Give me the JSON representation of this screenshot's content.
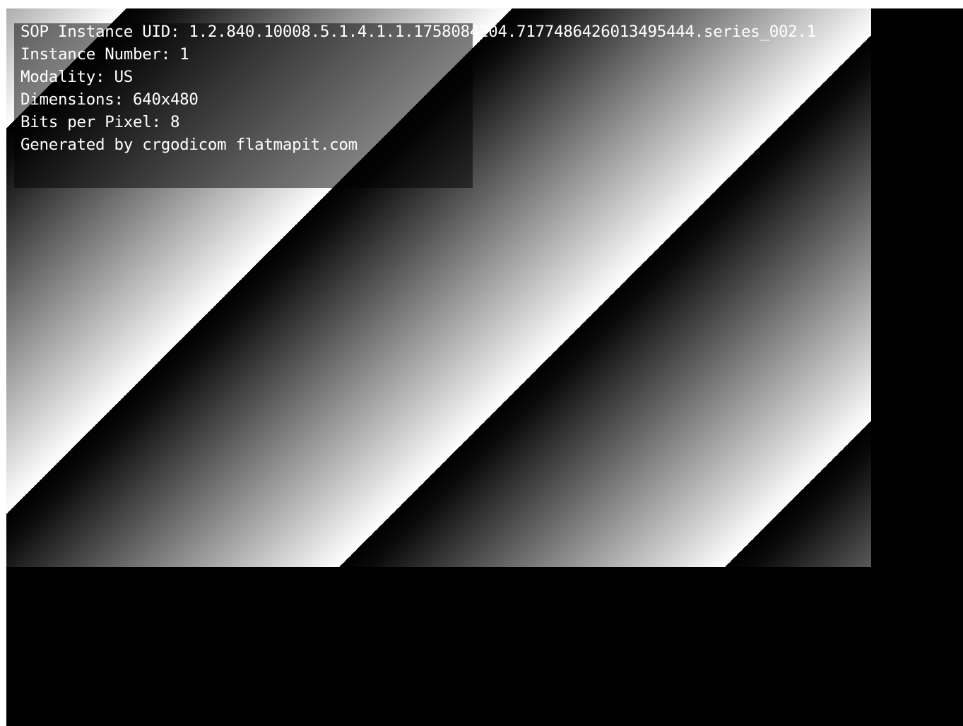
{
  "viewer": {
    "modality_image": {
      "pattern": "diagonal-gradient-stripes",
      "colors": {
        "dark": "#000000",
        "light": "#ffffff"
      }
    },
    "overlay": {
      "sop_instance_uid": "SOP Instance UID: 1.2.840.10008.5.1.4.1.1.1758084204.7177486426013495444.series_002.1",
      "instance_number": "Instance Number: 1",
      "modality": "Modality: US",
      "dimensions": "Dimensions: 640x480",
      "bits_per_pixel": "Bits per Pixel: 8",
      "generated_by": "Generated by crgodicom flatmapit.com"
    }
  }
}
